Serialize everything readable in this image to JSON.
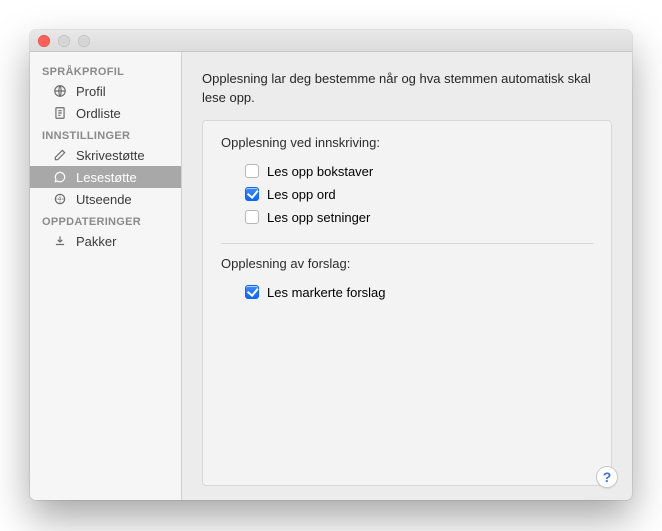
{
  "sidebar": {
    "sections": [
      {
        "header": "SPRÅKPROFIL",
        "items": [
          {
            "label": "Profil"
          },
          {
            "label": "Ordliste"
          }
        ]
      },
      {
        "header": "INNSTILLINGER",
        "items": [
          {
            "label": "Skrivestøtte"
          },
          {
            "label": "Lesestøtte"
          },
          {
            "label": "Utseende"
          }
        ]
      },
      {
        "header": "OPPDATERINGER",
        "items": [
          {
            "label": "Pakker"
          }
        ]
      }
    ]
  },
  "main": {
    "description": "Opplesning lar deg bestemme når og hva stemmen automatisk skal lese opp.",
    "group_typing_label": "Opplesning ved innskriving:",
    "checks": [
      {
        "label": "Les opp bokstaver",
        "checked": false
      },
      {
        "label": "Les opp ord",
        "checked": true
      },
      {
        "label": "Les opp setninger",
        "checked": false
      }
    ],
    "group_suggestions_label": "Opplesning av forslag:",
    "check_suggestions": {
      "label": "Les markerte forslag",
      "checked": true
    }
  },
  "help_label": "?"
}
